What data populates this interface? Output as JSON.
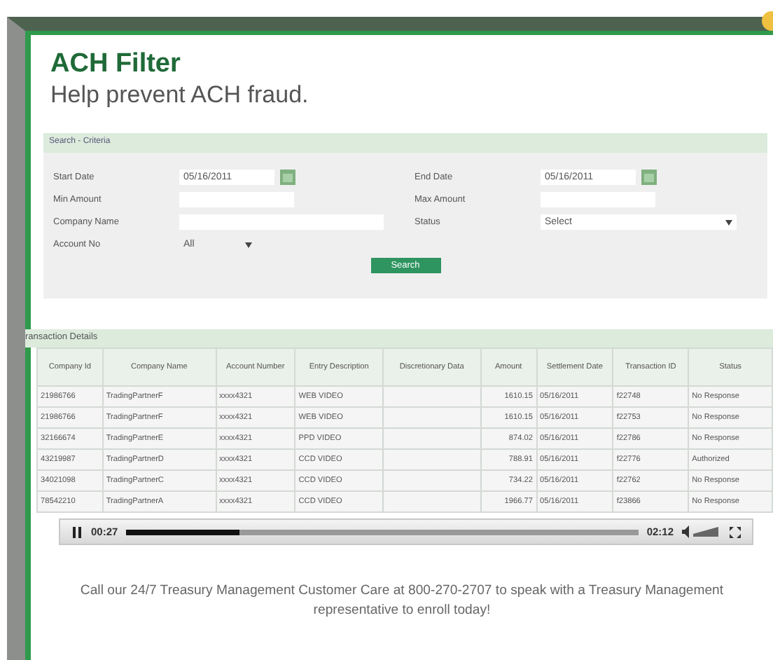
{
  "header": {
    "title": "ACH Filter",
    "subtitle": "Help prevent ACH fraud."
  },
  "search": {
    "heading": "Search - Criteria",
    "fields": [
      {
        "label": "Start Date",
        "kind": "date",
        "value": "05/16/2011"
      },
      {
        "label": "End Date",
        "kind": "date",
        "value": "05/16/2011"
      },
      {
        "label": "Min Amount",
        "kind": "amount"
      },
      {
        "label": "Max Amount",
        "kind": "amount"
      },
      {
        "label": "Company Name",
        "kind": "text"
      },
      {
        "label": "Status",
        "kind": "select",
        "value": "Select"
      },
      {
        "label": "Account No",
        "kind": "dropdown",
        "value": "All"
      }
    ],
    "button": "Search"
  },
  "transactions": {
    "heading": "ransaction Details",
    "columns": [
      "Company Id",
      "Company Name",
      "Account Number",
      "Entry Description",
      "Discretionary Data",
      "Amount",
      "Settlement Date",
      "Transaction ID",
      "Status"
    ],
    "rows": [
      {
        "company_id": "21986766",
        "company_name": "TradingPartnerF",
        "account_number": "xxxx4321",
        "entry_description": "WEB VIDEO",
        "amount": "1610.15",
        "settlement_date": "05/16/2011",
        "transaction_id": "f22748",
        "status": "No Response"
      },
      {
        "company_id": "21986766",
        "company_name": "TradingPartnerF",
        "account_number": "xxxx4321",
        "entry_description": "WEB VIDEO",
        "amount": "1610.15",
        "settlement_date": "05/16/2011",
        "transaction_id": "f22753",
        "status": "No Response"
      },
      {
        "company_id": "32166674",
        "company_name": "TradingPartnerE",
        "account_number": "xxxx4321",
        "entry_description": "PPD VIDEO",
        "amount": "874.02",
        "settlement_date": "05/16/2011",
        "transaction_id": "f22786",
        "status": "No Response"
      },
      {
        "company_id": "43219987",
        "company_name": "TradingPartnerD",
        "account_number": "xxxx4321",
        "entry_description": "CCD VIDEO",
        "amount": "788.91",
        "settlement_date": "05/16/2011",
        "transaction_id": "f22776",
        "status": "Authorized"
      },
      {
        "company_id": "34021098",
        "company_name": "TradingPartnerC",
        "account_number": "xxxx4321",
        "entry_description": "CCD VIDEO",
        "amount": "734.22",
        "settlement_date": "05/16/2011",
        "transaction_id": "f22762",
        "status": "No Response"
      },
      {
        "company_id": "78542210",
        "company_name": "TradingPartnerA",
        "account_number": "xxxx4321",
        "entry_description": "CCD VIDEO",
        "amount": "1966.77",
        "settlement_date": "05/16/2011",
        "transaction_id": "f23866",
        "status": "No Response"
      }
    ]
  },
  "video": {
    "playing": true,
    "elapsed": "00:27",
    "duration": "02:12",
    "level": 0.22
  },
  "footer": "Call our 24/7 Treasury Management Customer Care at 800-270-2707 to speak with a Treasury Management representative to enroll today!"
}
